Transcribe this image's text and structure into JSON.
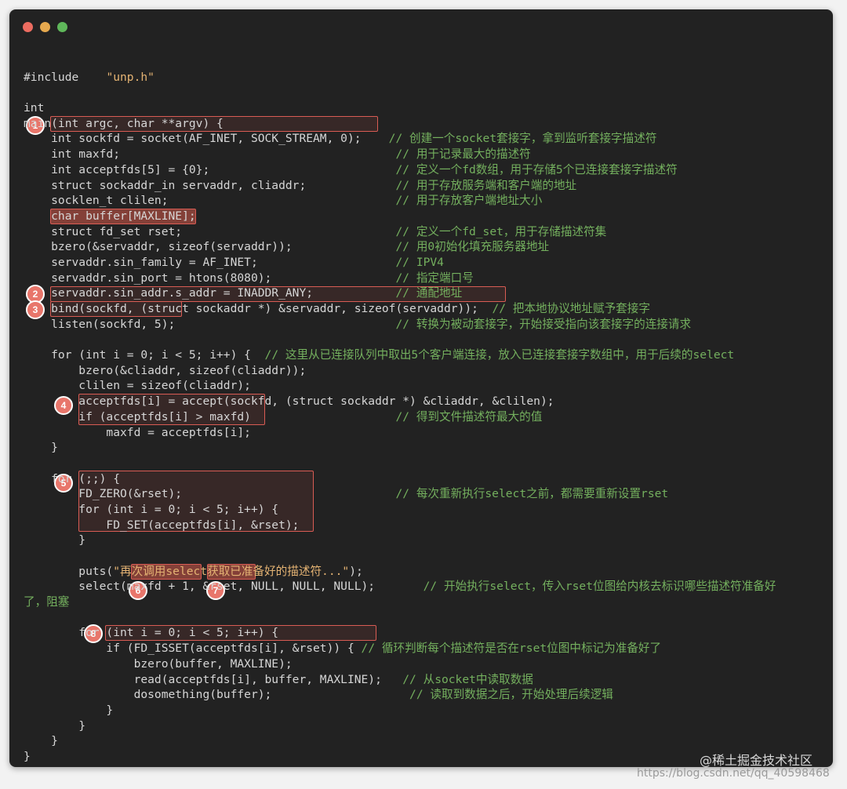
{
  "window_controls": {
    "close_color": "#ec6c60",
    "minimize_color": "#e6a94e",
    "maximize_color": "#5fb75a"
  },
  "code_lines": [
    "",
    "#include    \"unp.h\"",
    "",
    "int",
    "main(int argc, char **argv) {",
    "    int sockfd = socket(AF_INET, SOCK_STREAM, 0);    // 创建一个socket套接字，拿到监听套接字描述符",
    "    int maxfd;                                        // 用于记录最大的描述符",
    "    int acceptfds[5] = {0};                           // 定义一个fd数组，用于存储5个已连接套接字描述符",
    "    struct sockaddr_in servaddr, cliaddr;             // 用于存放服务端和客户端的地址",
    "    socklen_t clilen;                                 // 用于存放客户端地址大小",
    "    char buffer[MAXLINE];",
    "    struct fd_set rset;                               // 定义一个fd_set，用于存储描述符集",
    "    bzero(&servaddr, sizeof(servaddr));               // 用0初始化填充服务器地址",
    "    servaddr.sin_family = AF_INET;                    // IPV4",
    "    servaddr.sin_port = htons(8080);                  // 指定端口号",
    "    servaddr.sin_addr.s_addr = INADDR_ANY;            // 通配地址",
    "    bind(sockfd, (struct sockaddr *) &servaddr, sizeof(servaddr));  // 把本地协议地址赋予套接字",
    "    listen(sockfd, 5);                                // 转换为被动套接字，开始接受指向该套接字的连接请求",
    "",
    "    for (int i = 0; i < 5; i++) {  // 这里从已连接队列中取出5个客户端连接，放入已连接套接字数组中，用于后续的select",
    "        bzero(&cliaddr, sizeof(cliaddr));",
    "        clilen = sizeof(cliaddr);",
    "        acceptfds[i] = accept(sockfd, (struct sockaddr *) &cliaddr, &clilen);",
    "        if (acceptfds[i] > maxfd)                     // 得到文件描述符最大的值",
    "            maxfd = acceptfds[i];",
    "    }",
    "",
    "    for (;;) {",
    "        FD_ZERO(&rset);                               // 每次重新执行select之前，都需要重新设置rset",
    "        for (int i = 0; i < 5; i++) {",
    "            FD_SET(acceptfds[i], &rset);",
    "        }",
    "",
    "        puts(\"再次调用select获取已准备好的描述符...\");",
    "        select(maxfd + 1, &rset, NULL, NULL, NULL);       // 开始执行select，传入rset位图给内核去标识哪些描述符准备好",
    "了，阻塞",
    "",
    "        for (int i = 0; i < 5; i++) {",
    "            if (FD_ISSET(acceptfds[i], &rset)) { // 循环判断每个描述符是否在rset位图中标记为准备好了",
    "                bzero(buffer, MAXLINE);",
    "                read(acceptfds[i], buffer, MAXLINE);   // 从socket中读取数据",
    "                dosomething(buffer);                    // 读取到数据之后，开始处理后续逻辑",
    "            }",
    "        }",
    "    }",
    "}"
  ],
  "step_badges": [
    "1",
    "2",
    "3",
    "4",
    "5",
    "6",
    "7",
    "8"
  ],
  "watermarks": {
    "site": "@稀土掘金技术社区",
    "url": "https://blog.csdn.net/qq_40598468"
  }
}
